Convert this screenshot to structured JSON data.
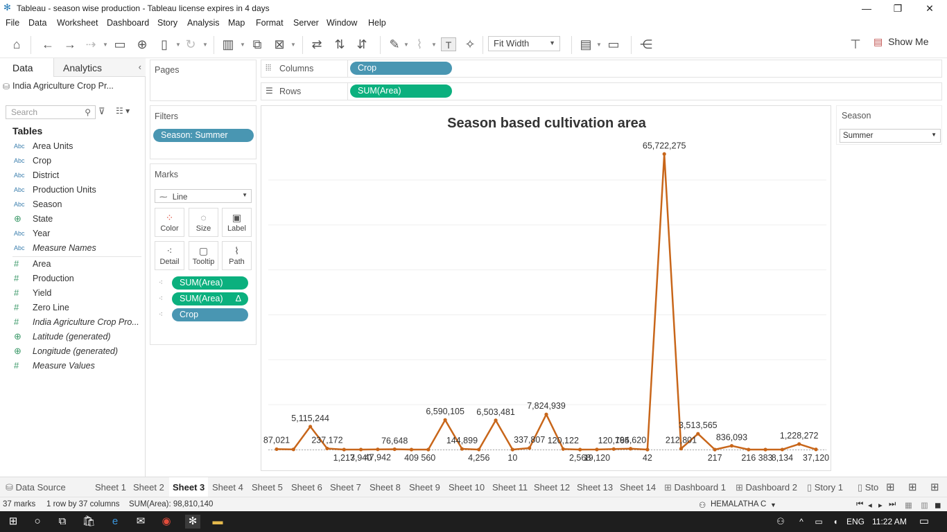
{
  "window": {
    "title": "Tableau - season wise production - Tableau license expires in 4 days"
  },
  "menu": [
    "File",
    "Data",
    "Worksheet",
    "Dashboard",
    "Story",
    "Analysis",
    "Map",
    "Format",
    "Server",
    "Window",
    "Help"
  ],
  "toolbar": {
    "fit": "Fit Width",
    "show_me": "Show Me"
  },
  "left": {
    "tab_data": "Data",
    "tab_analytics": "Analytics",
    "datasource": "India Agriculture Crop Pr...",
    "search_placeholder": "Search",
    "tables_heading": "Tables",
    "dimensions": [
      {
        "type": "Abc",
        "name": "Area Units"
      },
      {
        "type": "Abc",
        "name": "Crop"
      },
      {
        "type": "Abc",
        "name": "District"
      },
      {
        "type": "Abc",
        "name": "Production Units"
      },
      {
        "type": "Abc",
        "name": "Season"
      },
      {
        "type": "geo",
        "name": "State"
      },
      {
        "type": "Abc",
        "name": "Year"
      },
      {
        "type": "Abc",
        "name": "Measure Names"
      }
    ],
    "measures": [
      {
        "type": "#",
        "name": "Area"
      },
      {
        "type": "#",
        "name": "Production"
      },
      {
        "type": "#",
        "name": "Yield"
      },
      {
        "type": "#",
        "name": "Zero Line"
      },
      {
        "type": "#",
        "name": "India Agriculture Crop Pro..."
      },
      {
        "type": "geo",
        "name": "Latitude (generated)"
      },
      {
        "type": "geo",
        "name": "Longitude (generated)"
      },
      {
        "type": "#",
        "name": "Measure Values"
      }
    ]
  },
  "pages": {
    "label": "Pages"
  },
  "filters": {
    "label": "Filters",
    "pill": "Season: Summer"
  },
  "marks": {
    "label": "Marks",
    "type": "Line",
    "buttons": [
      "Color",
      "Size",
      "Label",
      "Detail",
      "Tooltip",
      "Path"
    ],
    "pills": [
      {
        "label": "SUM(Area)",
        "extra": ""
      },
      {
        "label": "SUM(Area)",
        "extra": "Δ"
      },
      {
        "label": "Crop",
        "extra": ""
      }
    ]
  },
  "shelves": {
    "columns_label": "Columns",
    "columns_pill": "Crop",
    "rows_label": "Rows",
    "rows_pill": "SUM(Area)"
  },
  "season_filter": {
    "label": "Season",
    "value": "Summer"
  },
  "chart_data": {
    "type": "line",
    "title": "Season based cultivation area",
    "xlabel": "",
    "ylabel": "",
    "values": [
      87021,
      40000,
      5115244,
      237172,
      1213,
      7940,
      47942,
      76648,
      409,
      560,
      6590105,
      144899,
      4256,
      6503481,
      10,
      337807,
      7824939,
      120122,
      2568,
      19120,
      120765,
      194620,
      42,
      65722275,
      212801,
      3513565,
      217,
      836093,
      216,
      383,
      8134,
      1228272,
      37120
    ],
    "labels": [
      "87,021",
      "",
      "5,115,244",
      "237,172",
      "1,213",
      "7,940",
      "47,942",
      "76,648",
      "409",
      "560",
      "6,590,105",
      "144,899",
      "4,256",
      "6,503,481",
      "10",
      "337,807",
      "7,824,939",
      "120,122",
      "2,568",
      "19,120",
      "120,765",
      "194,620",
      "42",
      "65,722,275",
      "212,801",
      "3,513,565",
      "217",
      "836,093",
      "216",
      "383",
      "8,134",
      "1,228,272",
      "37,120"
    ],
    "color": "#c8661a",
    "grid": true
  },
  "sheet_tabs": [
    "Data Source",
    "Sheet 1",
    "Sheet 2",
    "Sheet 3",
    "Sheet 4",
    "Sheet 5",
    "Sheet 6",
    "Sheet 7",
    "Sheet 8",
    "Sheet 9",
    "Sheet 10",
    "Sheet 11",
    "Sheet 12",
    "Sheet 13",
    "Sheet 14",
    "Dashboard 1",
    "Dashboard 2",
    "Story 1",
    "Sto"
  ],
  "active_tab": "Sheet 3",
  "status": {
    "marks": "37 marks",
    "dims": "1 row by 37 columns",
    "sum": "SUM(Area): 98,810,140",
    "user": "HEMALATHA C"
  },
  "taskbar": {
    "lang": "ENG",
    "time": "11:22 AM"
  }
}
